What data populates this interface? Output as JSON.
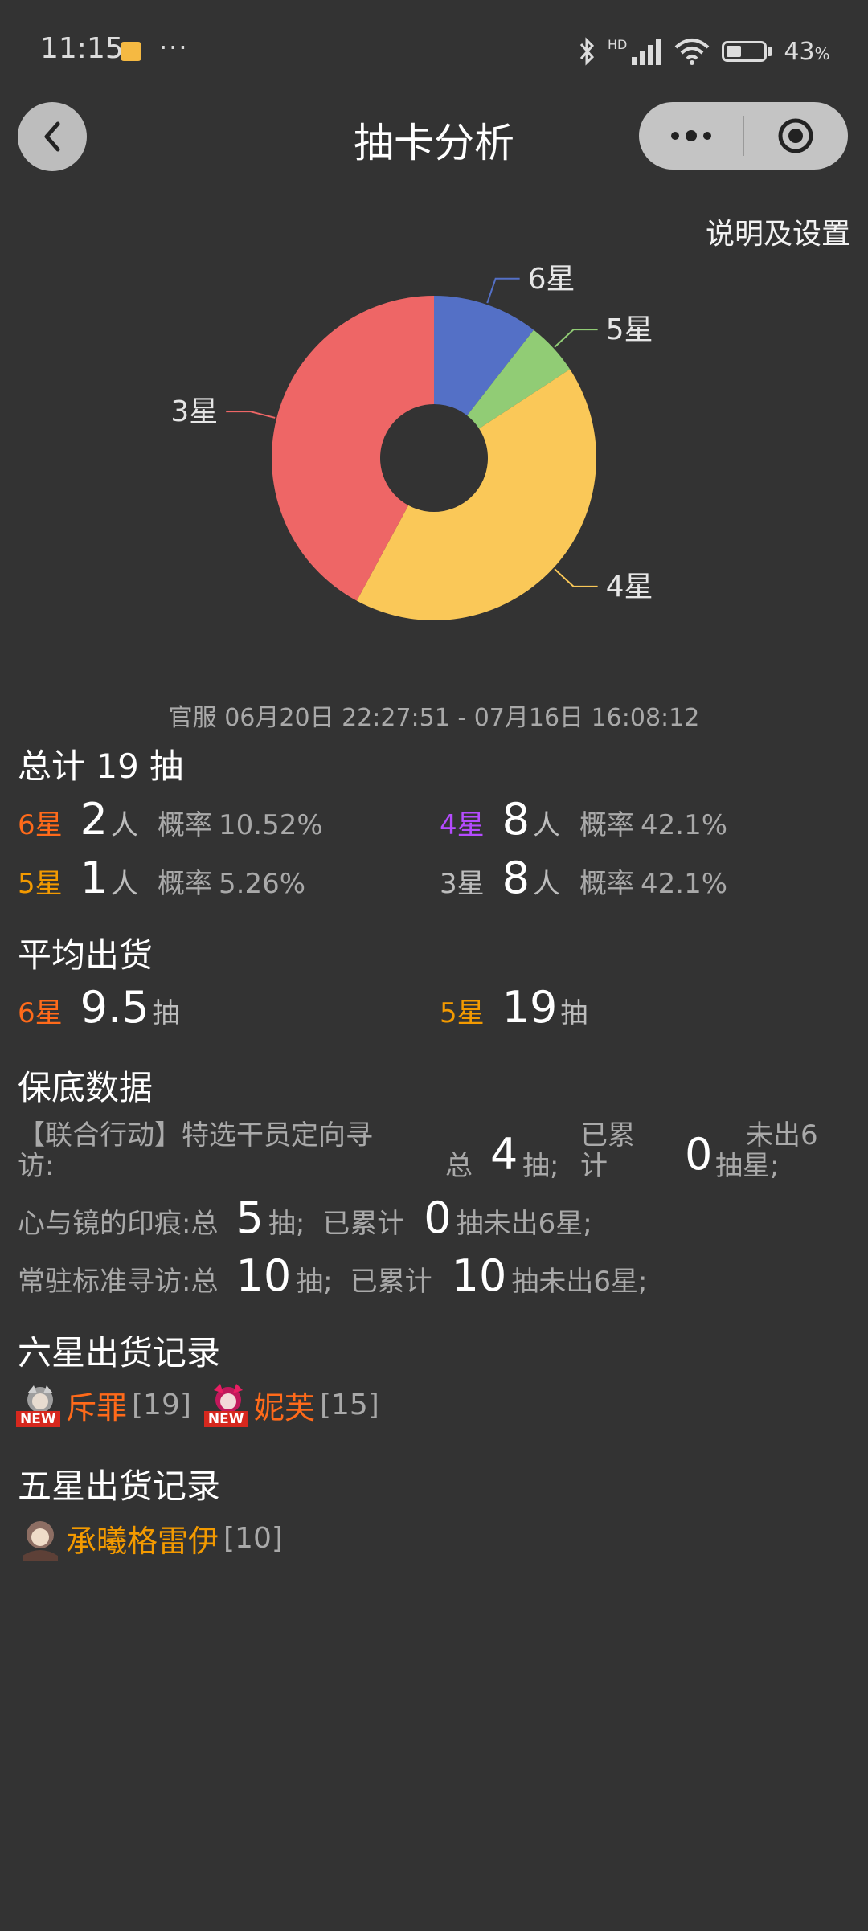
{
  "status_bar": {
    "time": "11:15",
    "dots": "···",
    "network": "HD",
    "battery": "43",
    "battery_unit": "%"
  },
  "header": {
    "title": "抽卡分析",
    "back_icon": "chevron-left-icon",
    "more_icon": "more-dots-icon",
    "close_icon": "target-circle-icon"
  },
  "settings_label": "说明及设置",
  "chart_data": {
    "type": "pie",
    "donut": true,
    "labels": [
      "6星",
      "5星",
      "4星",
      "3星"
    ],
    "values": [
      2,
      1,
      8,
      8
    ],
    "colors": [
      "#5470c6",
      "#91cc75",
      "#fac858",
      "#ee6666"
    ]
  },
  "server_range": "官服  06月20日 22:27:51  -  07月16日 16:08:12",
  "total": {
    "label": "总计 19 抽",
    "rows": [
      {
        "star": "6星",
        "count": "2",
        "unit": "人",
        "rate_label": "概率",
        "rate": "10.52%"
      },
      {
        "star": "4星",
        "count": "8",
        "unit": "人",
        "rate_label": "概率",
        "rate": "42.1%"
      },
      {
        "star": "5星",
        "count": "1",
        "unit": "人",
        "rate_label": "概率",
        "rate": "5.26%"
      },
      {
        "star": "3星",
        "count": "8",
        "unit": "人",
        "rate_label": "概率",
        "rate": "42.1%"
      }
    ]
  },
  "average": {
    "label": "平均出货",
    "items": [
      {
        "star": "6星",
        "value": "9.5",
        "unit": "抽"
      },
      {
        "star": "5星",
        "value": "19",
        "unit": "抽"
      }
    ]
  },
  "pity": {
    "label": "保底数据",
    "rows": [
      {
        "name": "【联合行动】特选干员定向寻访:",
        "total_prefix": "总",
        "total": "4",
        "total_unit": "抽;",
        "acc_label": "已累计",
        "acc": "0",
        "suffix": "抽未出6星;"
      },
      {
        "name": "心与镜的印痕:",
        "total_prefix": "总",
        "total": "5",
        "total_unit": "抽;",
        "acc_label": "已累计",
        "acc": "0",
        "suffix": "抽未出6星;"
      },
      {
        "name": "常驻标准寻访:",
        "total_prefix": "总",
        "total": "10",
        "total_unit": "抽;",
        "acc_label": "已累计",
        "acc": "10",
        "suffix": "抽未出6星;"
      }
    ],
    "row1_parts": {
      "a": "【联合行动】特选干员定向寻",
      "b": "访:",
      "c": "总",
      "d": "4",
      "e": "抽;",
      "f1": "已累",
      "f2": "计",
      "g": "0",
      "h1": "未出6",
      "h2": "抽星;"
    }
  },
  "six_star_records": {
    "label": "六星出货记录",
    "items": [
      {
        "name": "斥罪",
        "count": "[19]",
        "badge": "NEW"
      },
      {
        "name": "妮芙",
        "count": "[15]",
        "badge": "NEW"
      }
    ]
  },
  "five_star_records": {
    "label": "五星出货记录",
    "items": [
      {
        "name": "承曦格雷伊",
        "count": "[10]"
      }
    ]
  }
}
